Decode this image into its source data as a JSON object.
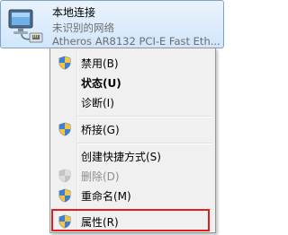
{
  "adapter": {
    "name": "本地连接",
    "status": "未识别的网络",
    "device": "Atheros AR8132 PCI-E Fast Eth...",
    "icon": "network-adapter-icon"
  },
  "menu": {
    "items": [
      {
        "label": "禁用(B)",
        "icon": "uac-shield-icon",
        "enabled": true
      },
      {
        "label": "状态(U)",
        "icon": "",
        "enabled": true,
        "bold": true
      },
      {
        "label": "诊断(I)",
        "icon": "",
        "enabled": true
      },
      {
        "label": "桥接(G)",
        "icon": "uac-shield-icon",
        "enabled": true
      },
      {
        "label": "创建快捷方式(S)",
        "icon": "",
        "enabled": true
      },
      {
        "label": "删除(D)",
        "icon": "uac-shield-icon",
        "enabled": false
      },
      {
        "label": "重命名(M)",
        "icon": "uac-shield-icon",
        "enabled": true
      },
      {
        "label": "属性(R)",
        "icon": "uac-shield-icon",
        "enabled": true,
        "highlighted": true
      }
    ]
  },
  "colors": {
    "highlight_outline": "#e21d1d",
    "selection_border": "#7da2ce",
    "menu_background": "#f0f0f0"
  }
}
